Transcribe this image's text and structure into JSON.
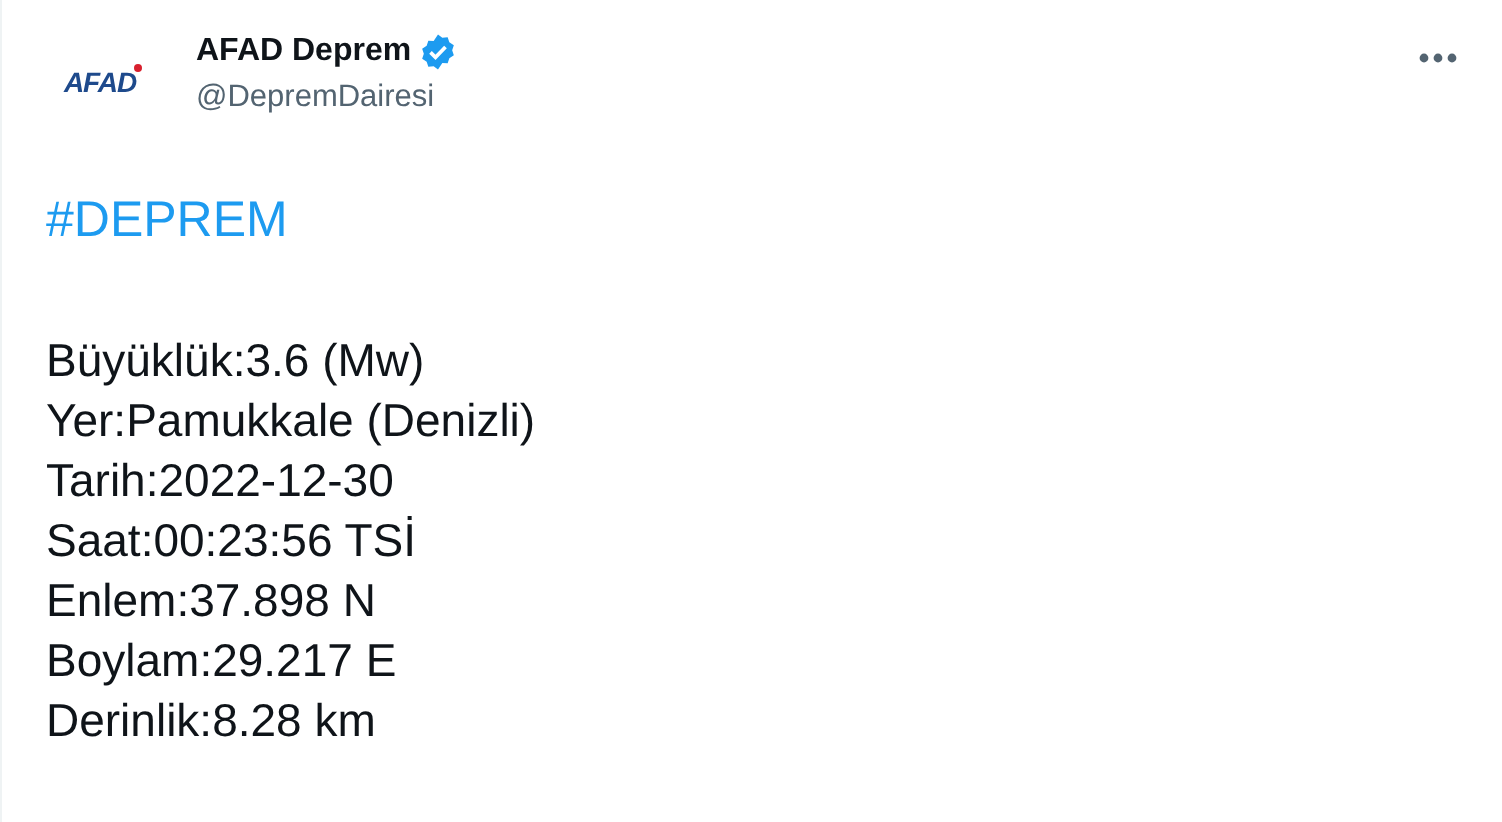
{
  "tweet": {
    "avatar_logo": "AFAD",
    "author_name": "AFAD Deprem",
    "verified": true,
    "handle": "@DepremDairesi",
    "hashtag": "#DEPREM",
    "lines": [
      "Büyüklük:3.6 (Mw)",
      "Yer:Pamukkale (Denizli)",
      "Tarih:2022-12-30",
      "Saat:00:23:56 TSİ",
      "Enlem:37.898 N",
      "Boylam:29.217 E",
      "Derinlik:8.28 km"
    ]
  }
}
